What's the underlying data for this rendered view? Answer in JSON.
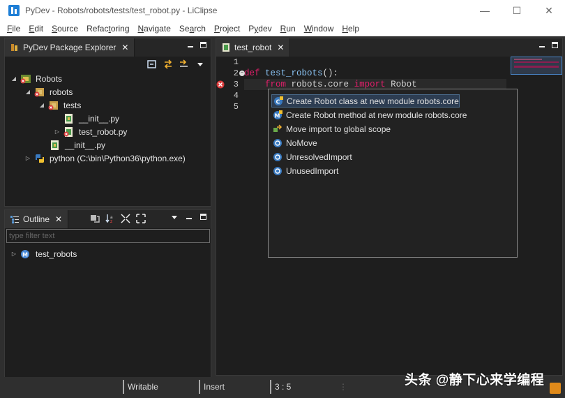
{
  "window": {
    "title": "PyDev - Robots/robots/tests/test_robot.py - LiClipse",
    "minimize": "—",
    "maximize": "☐",
    "close": "✕"
  },
  "menu": [
    {
      "u": "F",
      "rest": "ile"
    },
    {
      "u": "E",
      "rest": "dit"
    },
    {
      "u": "S",
      "rest": "ource"
    },
    {
      "pre": "Refac",
      "u": "t",
      "rest": "oring"
    },
    {
      "u": "N",
      "rest": "avigate"
    },
    {
      "pre": "Se",
      "u": "a",
      "rest": "rch"
    },
    {
      "u": "P",
      "rest": "roject"
    },
    {
      "pre": "P",
      "u": "y",
      "rest": "dev"
    },
    {
      "u": "R",
      "rest": "un"
    },
    {
      "u": "W",
      "rest": "indow"
    },
    {
      "u": "H",
      "rest": "elp"
    }
  ],
  "package_explorer": {
    "tab_label": "PyDev Package Explorer",
    "tree": [
      {
        "label": "Robots",
        "twisty": "◢"
      },
      {
        "label": "robots",
        "twisty": "◢"
      },
      {
        "label": "tests",
        "twisty": "◢"
      },
      {
        "label": "__init__.py",
        "twisty": ""
      },
      {
        "label": "test_robot.py",
        "twisty": "▷"
      },
      {
        "label": "__init__.py",
        "twisty": ""
      },
      {
        "label": "python  (C:\\bin\\Python36\\python.exe)",
        "twisty": "▷"
      }
    ]
  },
  "outline": {
    "tab_label": "Outline",
    "filter_placeholder": "type filter text",
    "items": [
      {
        "label": "test_robots",
        "twisty": "▷"
      }
    ]
  },
  "editor": {
    "tab_label": "test_robot",
    "line_numbers": [
      "1",
      "2",
      "3",
      "4",
      "5"
    ],
    "code": {
      "l2_kw": "def ",
      "l2_fn": "test_robots",
      "l2_rest": "():",
      "l3_indent": "    ",
      "l3_kw1": "from",
      "l3_mid": " robots.core ",
      "l3_kw2": "import",
      "l3_rest": " Robot"
    }
  },
  "quickfix": {
    "items": [
      "Create Robot class at new module robots.core",
      "Create Robot method at new module robots.core",
      "Move import to global scope",
      "NoMove",
      "UnresolvedImport",
      "UnusedImport"
    ]
  },
  "status": {
    "writable": "Writable",
    "insert": "Insert",
    "position": "3 : 5"
  },
  "watermark": "头条 @静下心来学编程",
  "colors": {
    "keyword": "#e01f6a",
    "function": "#88c0f0",
    "error": "#d93a3a"
  }
}
